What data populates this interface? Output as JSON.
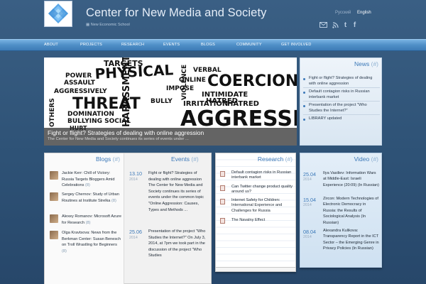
{
  "header": {
    "title": "Center for New Media and Society",
    "subtitle": "New Economic School",
    "languages": [
      "Русский",
      "English"
    ],
    "social_icons": [
      "mail-icon",
      "rss-icon",
      "twitter-icon",
      "facebook-icon"
    ]
  },
  "nav": {
    "items": [
      "ABOUT",
      "PROJECTS",
      "RESEARCH",
      "EVENTS",
      "BLOGS",
      "COMMUNITY",
      "GET INVOLVED"
    ]
  },
  "featured": {
    "title": "Fight or flight? Strategies of dealing with online aggression",
    "text": "The Center for New Media and Society continues its series of events under ..."
  },
  "news": {
    "heading": "News",
    "count": "(#)",
    "items": [
      "Fight or flight? Strategies of dealing with online aggression",
      "Default contagion risks in Russian interbank market",
      "Presentation of the project \"Who Studies the Internet?\"",
      "LIBRARY updated"
    ]
  },
  "blogs": {
    "heading": "Blogs",
    "count": "(#)",
    "items": [
      {
        "text": "Jackie Kerr: Chill of Victory: Russia Targets Bloggers Amid Celebrations",
        "count": "(8)"
      },
      {
        "text": "Sergey Chernov: Study of Urban Routines at Institute Strelka",
        "count": "(8)"
      },
      {
        "text": "Alexey Romanov: Microsoft Azure for Research",
        "count": "(8)"
      },
      {
        "text": "Olga Kravtsova: News from the Berkman Center: Susan Benesch on Troll Wrastling for Beginners",
        "count": "(8)"
      }
    ]
  },
  "events": {
    "heading": "Events",
    "count": "(#)",
    "items": [
      {
        "date": "13.10",
        "year": "2014",
        "text": "Fight or flight? Strategies of dealing with online aggression The Center for New Media and Society continues its series of events under the common topic \"Online Aggression: Causes, Types and Methods ..."
      },
      {
        "date": "25.06",
        "year": "2014",
        "text": "Presentation of the project \"Who Studies the Internet?\" On July 3, 2014, at 7pm we took part in the discussion of the project \"Who Studies"
      }
    ]
  },
  "research": {
    "heading": "Research",
    "count": "(#)",
    "items": [
      "Default contagion risks in Russian interbank market",
      "Can Twitter change product quality around us?",
      "Internet Safety for Children: International Experience and Challenges for Russia",
      "The Navalny Effect"
    ]
  },
  "video": {
    "heading": "Video",
    "count": "(#)",
    "items": [
      {
        "date": "25.04",
        "year": "2014",
        "text": "Ilya Vasiliev: Information Wars at Middle-East: Israeli Experience (20:09) (In Russian)"
      },
      {
        "date": "15.04",
        "year": "2014",
        "text": "Zircon: Modern Technologies of Electronic Democracy in Russia: the Results of Sociological Analysis (In Russian)"
      },
      {
        "date": "08.04",
        "year": "2014",
        "text": "Alexandra Kulikova: Transparency Report in the ICT Sector – the Emerging Genre in Privacy Policies (In Russian)"
      }
    ]
  },
  "colors": {
    "background": "#2e5276",
    "nav": "#4f8fc7",
    "accent": "#3b78b8"
  }
}
